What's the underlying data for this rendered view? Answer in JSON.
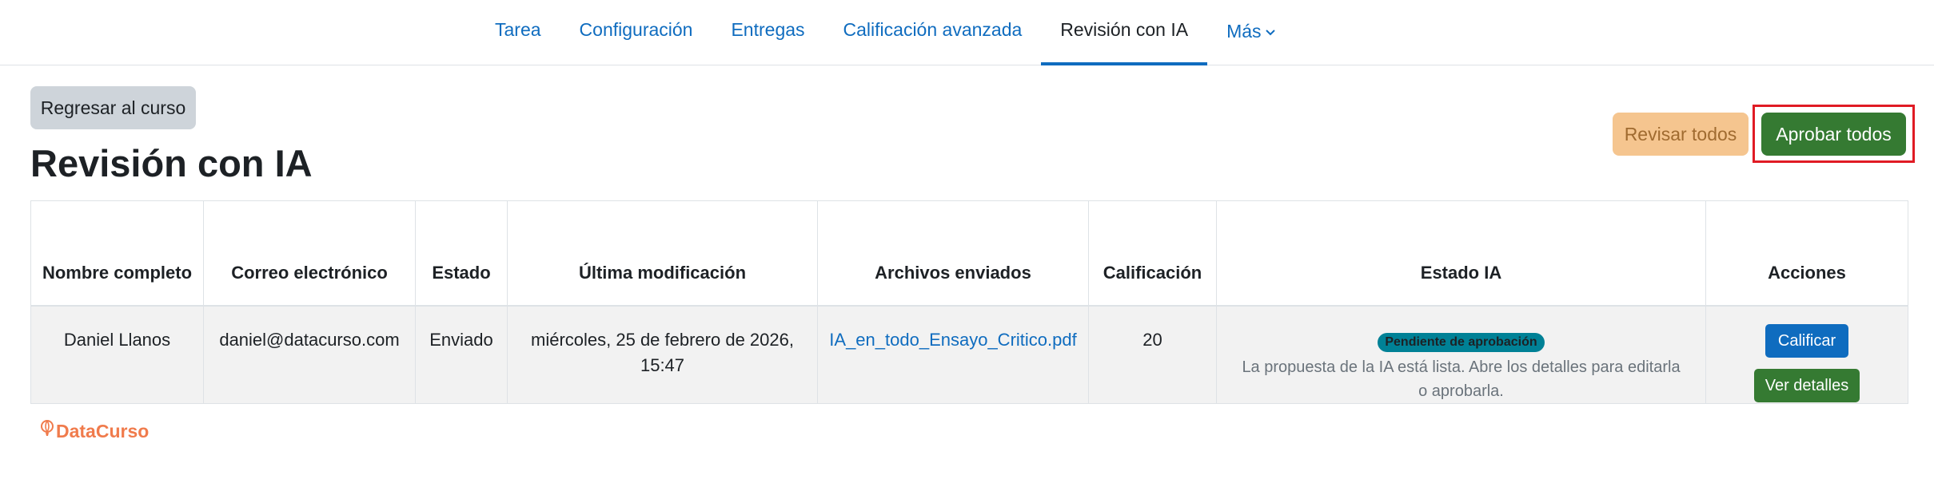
{
  "nav": {
    "items": [
      {
        "label": "Tarea",
        "active": false
      },
      {
        "label": "Configuración",
        "active": false
      },
      {
        "label": "Entregas",
        "active": false
      },
      {
        "label": "Calificación avanzada",
        "active": false
      },
      {
        "label": "Revisión con IA",
        "active": true
      },
      {
        "label": "Más",
        "active": false,
        "has_dropdown": true,
        "icon": "chevron-down-icon"
      }
    ]
  },
  "header": {
    "back_label": "Regresar al curso",
    "title": "Revisión con IA",
    "review_all_label": "Revisar todos",
    "approve_all_label": "Aprobar todos"
  },
  "table": {
    "columns": [
      "Nombre completo",
      "Correo electrónico",
      "Estado",
      "Última modificación",
      "Archivos enviados",
      "Calificación",
      "Estado IA",
      "Acciones"
    ],
    "rows": [
      {
        "name": "Daniel Llanos",
        "email": "daniel@datacurso.com",
        "status": "Enviado",
        "modified": "miércoles, 25 de febrero de 2026, 15:47",
        "file": "IA_en_todo_Ensayo_Critico.pdf",
        "grade": "20",
        "ia_badge": "Pendiente de aprobación",
        "ia_note": "La propuesta de la IA está lista. Abre los detalles para editarla o aprobarla.",
        "grade_button": "Calificar",
        "details_button": "Ver detalles"
      }
    ]
  },
  "footer": {
    "logo_text": "DataCurso",
    "logo_icon": "balloon-icon"
  },
  "colors": {
    "link": "#0f6cbf",
    "approve": "#357a32",
    "review": "#f5c58f",
    "highlight": "#e01b24",
    "badge": "#008196",
    "brand": "#f07b4c"
  }
}
